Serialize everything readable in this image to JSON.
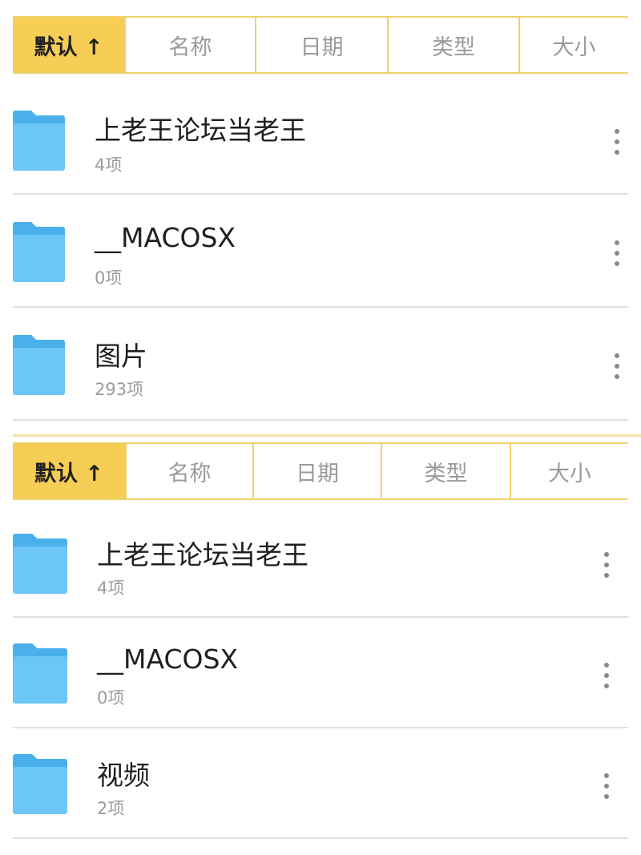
{
  "sort_bar": {
    "options": [
      "默认 ↑",
      "名称",
      "日期",
      "类型",
      "大小"
    ],
    "active": "默认 ↑"
  },
  "panels": [
    {
      "items": [
        {
          "name": "上老王论坛当老王",
          "count": "4项"
        },
        {
          "name": "__MACOSX",
          "count": "0项"
        },
        {
          "name": "图片",
          "count": "293项"
        }
      ]
    },
    {
      "items": [
        {
          "name": "上老王论坛当老王",
          "count": "4项"
        },
        {
          "name": "__MACOSX",
          "count": "0项"
        },
        {
          "name": "视频",
          "count": "2项"
        }
      ]
    }
  ],
  "colors": {
    "accent": "#f6cd55",
    "accent_border": "#f1d16a",
    "folder_body": "#6cc6f7",
    "folder_tab": "#4ab0ec",
    "divider": "#e0e0e0"
  },
  "icons": {
    "folder": "folder-icon",
    "more": "more-vertical-icon"
  }
}
